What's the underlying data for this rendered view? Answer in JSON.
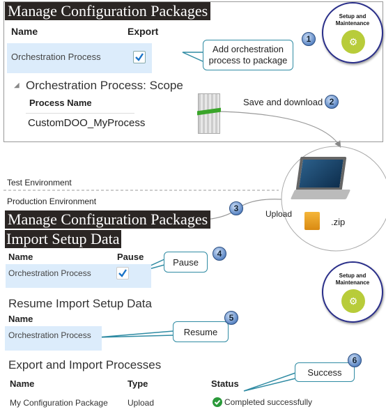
{
  "export_panel": {
    "title": "Manage Configuration Packages",
    "col_name": "Name",
    "col_export": "Export",
    "row_name": "Orchestration Process",
    "row_export_checked": true,
    "scope_title": "Orchestration Process: Scope",
    "scope_col": "Process Name",
    "scope_value": "CustomDOO_MyProcess"
  },
  "setup_icon_label": "Setup and Maintenance",
  "steps": [
    {
      "number": "1",
      "text": "Add orchestration process to package"
    },
    {
      "number": "2",
      "text": "Save and download"
    },
    {
      "number": "3",
      "text": "Upload"
    },
    {
      "number": "4",
      "text": "Pause"
    },
    {
      "number": "5",
      "text": "Resume"
    },
    {
      "number": "6",
      "text": "Success"
    }
  ],
  "zip_label": ".zip",
  "environments": {
    "test": "Test Environment",
    "production": "Production Environment"
  },
  "import_panel": {
    "title": "Manage Configuration Packages",
    "subtitle": "Import Setup Data",
    "col_name": "Name",
    "col_pause": "Pause",
    "row_name": "Orchestration Process",
    "row_pause_checked": true
  },
  "resume_panel": {
    "title": "Resume Import Setup Data",
    "col_name": "Name",
    "row_name": "Orchestration Process"
  },
  "processes_panel": {
    "title": "Export and Import Processes",
    "columns": [
      "Name",
      "Type",
      "Status"
    ],
    "row": {
      "name": "My Configuration Package",
      "type": "Upload",
      "status": "Completed successfully"
    },
    "status_color": "#2a9a3a"
  }
}
